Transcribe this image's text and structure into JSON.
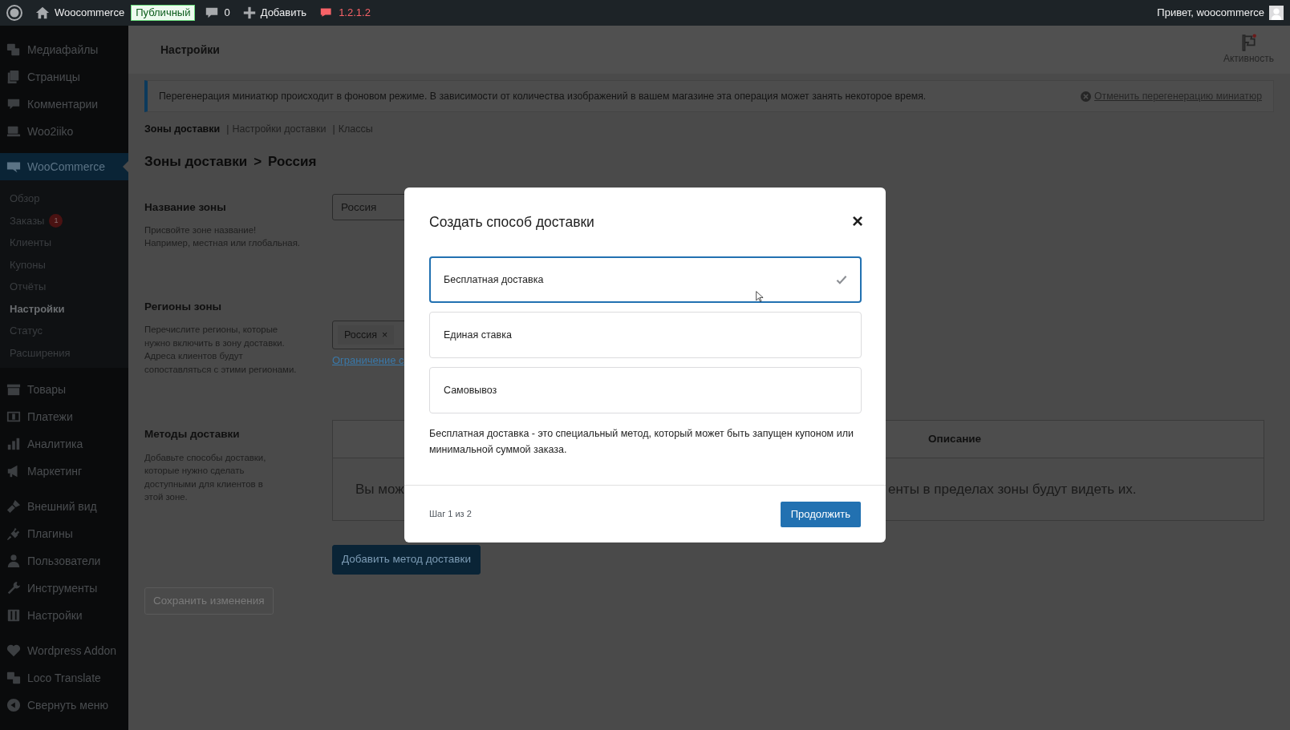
{
  "admin_bar": {
    "site": "Woocommerce",
    "badge": "Публичный",
    "comments": "0",
    "add": "Добавить",
    "version": "1.2.1.2",
    "greeting": "Привет, woocommerce"
  },
  "sidebar": {
    "groups": [
      {
        "items": [
          {
            "label": "Медиафайлы",
            "selected": false
          },
          {
            "label": "Страницы",
            "selected": false
          },
          {
            "label": "Комментарии",
            "selected": false
          },
          {
            "label": "Woo2iiko",
            "selected": false
          }
        ]
      },
      {
        "items": [
          {
            "label": "WooCommerce",
            "selected": true,
            "children": [
              {
                "label": "Обзор",
                "selected": false
              },
              {
                "label": "Заказы",
                "badge": "1",
                "selected": false
              },
              {
                "label": "Клиенты",
                "selected": false
              },
              {
                "label": "Купоны",
                "selected": false
              },
              {
                "label": "Отчёты",
                "selected": false
              },
              {
                "label": "Настройки",
                "selected": true
              },
              {
                "label": "Статус",
                "selected": false
              },
              {
                "label": "Расширения",
                "selected": false
              }
            ]
          }
        ]
      },
      {
        "items": [
          {
            "label": "Товары",
            "selected": false
          },
          {
            "label": "Платежи",
            "selected": false
          },
          {
            "label": "Аналитика",
            "selected": false
          },
          {
            "label": "Маркетинг",
            "selected": false
          }
        ]
      },
      {
        "items": [
          {
            "label": "Внешний вид",
            "selected": false
          },
          {
            "label": "Плагины",
            "selected": false
          },
          {
            "label": "Пользователи",
            "selected": false
          },
          {
            "label": "Инструменты",
            "selected": false
          },
          {
            "label": "Настройки",
            "selected": false
          }
        ]
      },
      {
        "items": [
          {
            "label": "Wordpress Addon",
            "selected": false
          },
          {
            "label": "Loco Translate",
            "selected": false
          },
          {
            "label": "Свернуть меню",
            "selected": false
          }
        ]
      }
    ]
  },
  "header": {
    "title": "Настройки",
    "activity": "Активность"
  },
  "notice": {
    "text": "Перегенерация миниатюр происходит в фоновом режиме. В зависимости от количества изображений в вашем магазине эта операция может занять некоторое время.",
    "action": "Отменить перегенерацию миниатюр"
  },
  "subnav": {
    "separator": "|",
    "items": [
      {
        "label": "Зоны доставки",
        "selected": true
      },
      {
        "label": "Настройки доставки",
        "selected": false
      },
      {
        "label": "Классы",
        "selected": false
      }
    ]
  },
  "breadcrumb": {
    "link": "Зоны доставки",
    "separator": ">",
    "current": "Россия"
  },
  "zone_name": {
    "label": "Название зоны",
    "help": [
      "Присвойте зоне название!",
      "Например, местная или глобальная."
    ],
    "value": "Россия"
  },
  "regions": {
    "label": "Регионы зоны",
    "help": [
      "Перечислите регионы, которые",
      "нужно включить в зону доставки.",
      "Адреса клиентов будут",
      "сопоставляться с этими регионами."
    ],
    "chips": [
      {
        "label": "Россия",
        "remove": "×"
      }
    ],
    "link": "Ограничение с"
  },
  "methods": {
    "label": "Методы доставки",
    "help": [
      "Добавьте способы доставки,",
      "которые нужно сделать",
      "доступными для клиентов в",
      "этой зоне."
    ],
    "table": {
      "columns": [
        "Описание"
      ],
      "empty_left": "Вы мож",
      "empty_right": "енты в пределах зоны будут видеть их."
    },
    "add_button": "Добавить метод доставки"
  },
  "save_button": {
    "label": "Сохранить изменения",
    "disabled": true
  },
  "modal": {
    "title": "Создать способ доставки",
    "close": "×",
    "options": [
      {
        "label": "Бесплатная доставка",
        "selected": true
      },
      {
        "label": "Единая ставка",
        "selected": false
      },
      {
        "label": "Самовывоз",
        "selected": false
      }
    ],
    "description": "Бесплатная доставка - это специальный метод, который может быть запущен купоном или минимальной суммой заказа.",
    "step": "Шаг 1 из 2",
    "continue": "Продолжить"
  }
}
